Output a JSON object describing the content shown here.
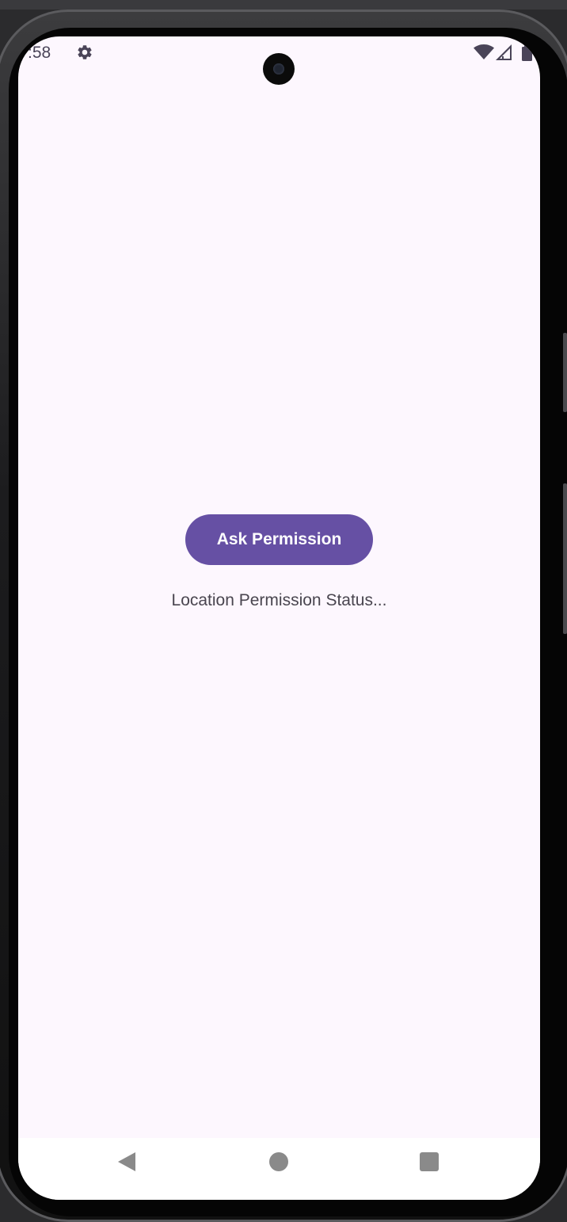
{
  "status_bar": {
    "time": ":58",
    "settings_icon": "gear-icon",
    "wifi_icon": "wifi-icon",
    "signal_icon": "cell-signal-icon",
    "battery_icon": "battery-icon"
  },
  "main": {
    "ask_button_label": "Ask Permission",
    "status_label": "Location Permission Status..."
  },
  "nav_bar": {
    "back_icon": "back-triangle-icon",
    "home_icon": "home-circle-icon",
    "recents_icon": "recents-square-icon"
  },
  "colors": {
    "screen_background": "#fdf7fe",
    "primary_button": "#6650a4",
    "button_text": "#ffffff",
    "body_text": "#49454f",
    "status_bar_text": "#4a4458"
  }
}
